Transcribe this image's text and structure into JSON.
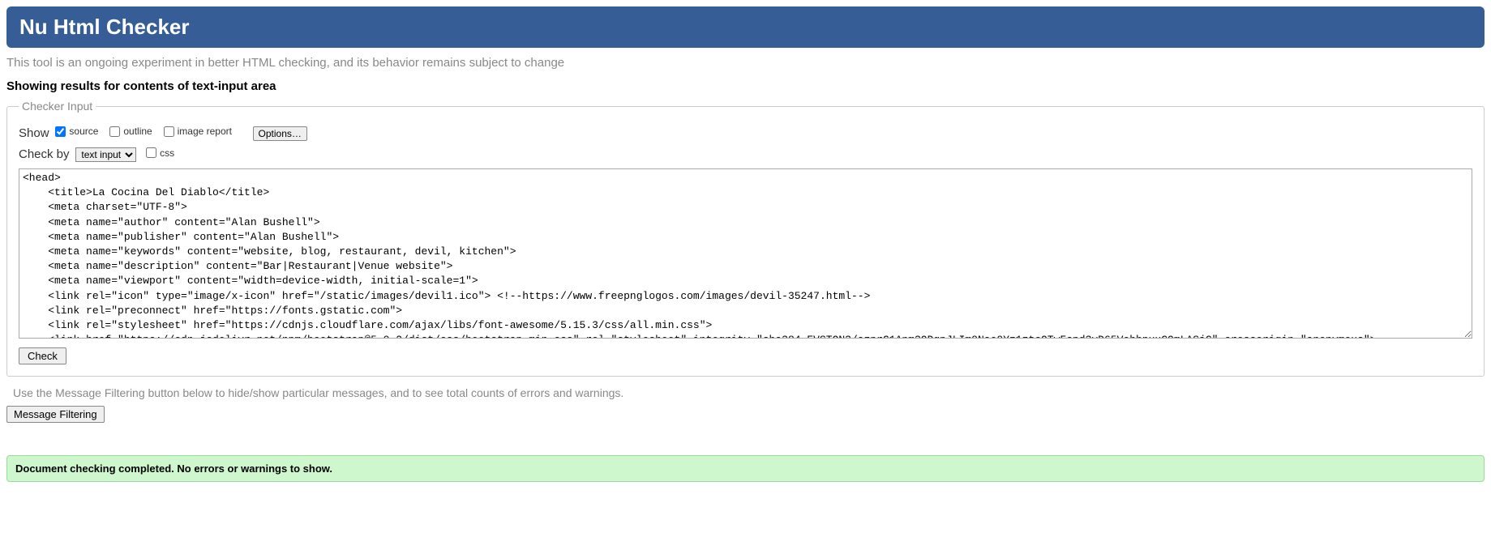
{
  "header": {
    "title": "Nu Html Checker"
  },
  "subtitle": "This tool is an ongoing experiment in better HTML checking, and its behavior remains subject to change",
  "results_heading": "Showing results for contents of text-input area",
  "checker": {
    "legend": "Checker Input",
    "show_label": "Show",
    "source_label": "source",
    "outline_label": "outline",
    "image_report_label": "image report",
    "options_label": "Options…",
    "check_by_label": "Check by",
    "check_by_selected": "text input",
    "css_label": "css",
    "textarea_value": "<head>\n    <title>La Cocina Del Diablo</title>\n    <meta charset=\"UTF-8\">\n    <meta name=\"author\" content=\"Alan Bushell\">\n    <meta name=\"publisher\" content=\"Alan Bushell\">\n    <meta name=\"keywords\" content=\"website, blog, restaurant, devil, kitchen\">\n    <meta name=\"description\" content=\"Bar|Restaurant|Venue website\">\n    <meta name=\"viewport\" content=\"width=device-width, initial-scale=1\">\n    <link rel=\"icon\" type=\"image/x-icon\" href=\"/static/images/devil1.ico\"> <!--https://www.freepnglogos.com/images/devil-35247.html-->\n    <link rel=\"preconnect\" href=\"https://fonts.gstatic.com\">\n    <link rel=\"stylesheet\" href=\"https://cdnjs.cloudflare.com/ajax/libs/font-awesome/5.15.3/css/all.min.css\">\n    <link href=\"https://cdn.jsdelivr.net/npm/bootstrap@5.0.2/dist/css/bootstrap.min.css\" rel=\"stylesheet\" integrity=\"sha384-EVSTQN3/azprG1Anm3QDgpJLIm9Nao0Yz1ztcQTwFspd3yD65VohhpuuCOmLASjC\" crossorigin=\"anonymous\">\n    <script src=\"https://cdn.jsdelivr.net/npm/bootstrap@5.0.2/dist/js/bootstrap.bundle.min.js\" integrity=\"sha384-MrcW6ZMFYlzcLA8Nl+NtUVF0sA7MsXsP1UyJoMp4YLEuNSfAP+JcXn/tWtIaxVXM\" crossorigin=\"anonymous\"></script>\n    <script src=\"https://kit.fontawesome.com/3af9543e24.js\" crossorigin=\"anonymous\"></script>\n    <link rel=\"stylesheet\" href=\"/static/css/style.css\">",
    "check_button": "Check"
  },
  "filter_note": "Use the Message Filtering button below to hide/show particular messages, and to see total counts of errors and warnings.",
  "filter_button": "Message Filtering",
  "success_message": "Document checking completed. No errors or warnings to show."
}
